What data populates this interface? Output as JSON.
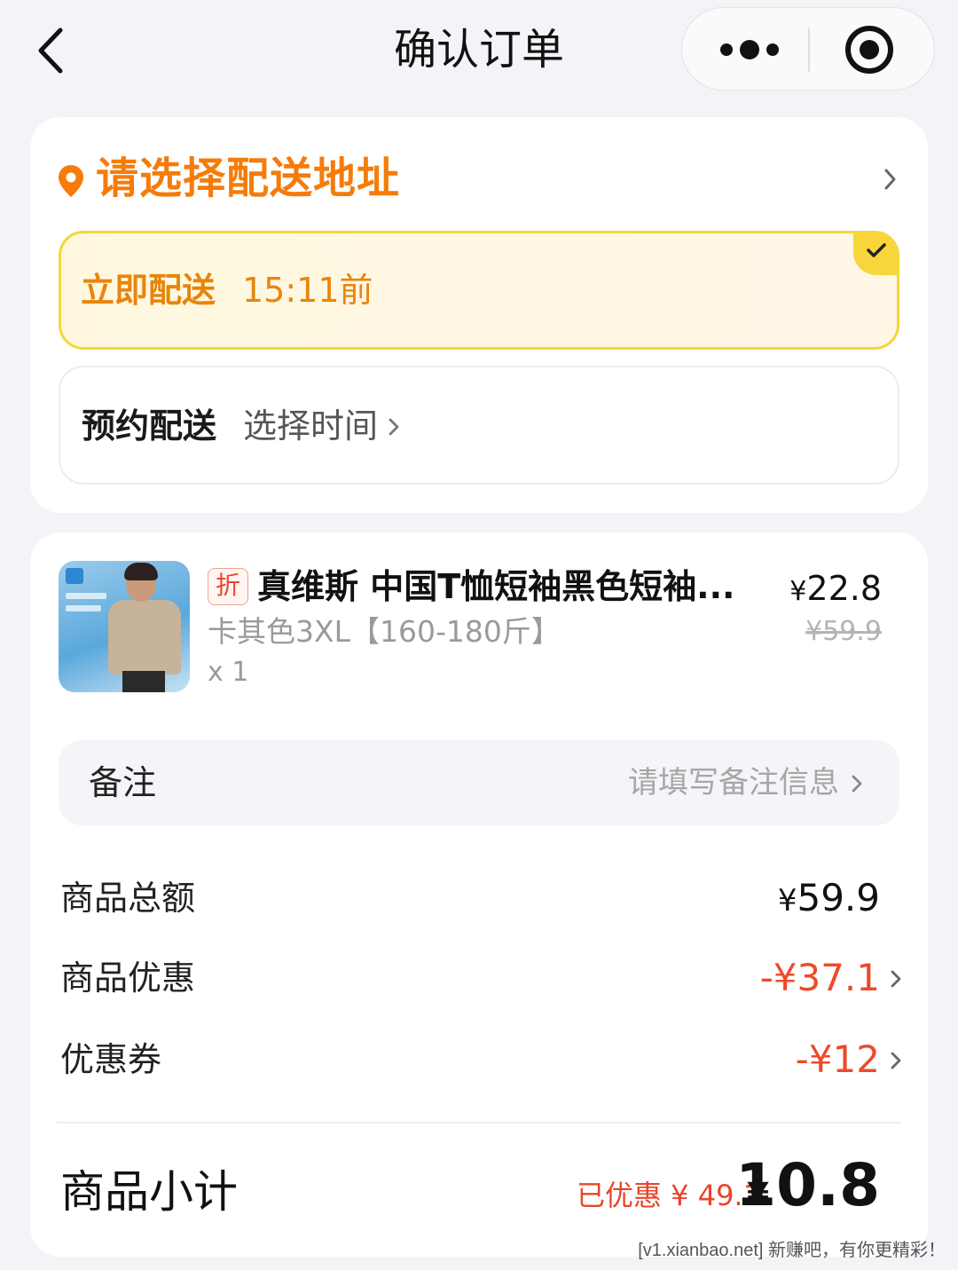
{
  "header": {
    "title": "确认订单",
    "back_icon": "chevron-left-icon",
    "more_icon": "more-dots-icon",
    "close_icon": "target-close-icon"
  },
  "address": {
    "prompt": "请选择配送地址",
    "color": "#f57c0a"
  },
  "delivery": {
    "now_label": "立即配送",
    "now_time": "15:11前",
    "now_selected": true,
    "schedule_label": "预约配送",
    "schedule_action": "选择时间"
  },
  "product": {
    "tag": "折",
    "name": "真维斯 中国T恤短袖黑色短袖...",
    "sku": "卡其色3XL【160-180斤】",
    "qty": "x 1",
    "price_symbol": "¥",
    "price": "22.8",
    "original_price": "¥59.9"
  },
  "remark": {
    "label": "备注",
    "placeholder": "请填写备注信息"
  },
  "summary": {
    "total_label": "商品总额",
    "total_symbol": "¥",
    "total_value": "59.9",
    "discount_label": "商品优惠",
    "discount_value": "-¥37.1",
    "coupon_label": "优惠券",
    "coupon_value": "-¥12",
    "accent_red": "#ee4a2b"
  },
  "subtotal": {
    "label": "商品小计",
    "saved": "已优惠 ¥ 49.1",
    "symbol": "¥",
    "amount": "10.8"
  },
  "watermark": "[v1.xianbao.net] 新赚吧，有你更精彩！"
}
